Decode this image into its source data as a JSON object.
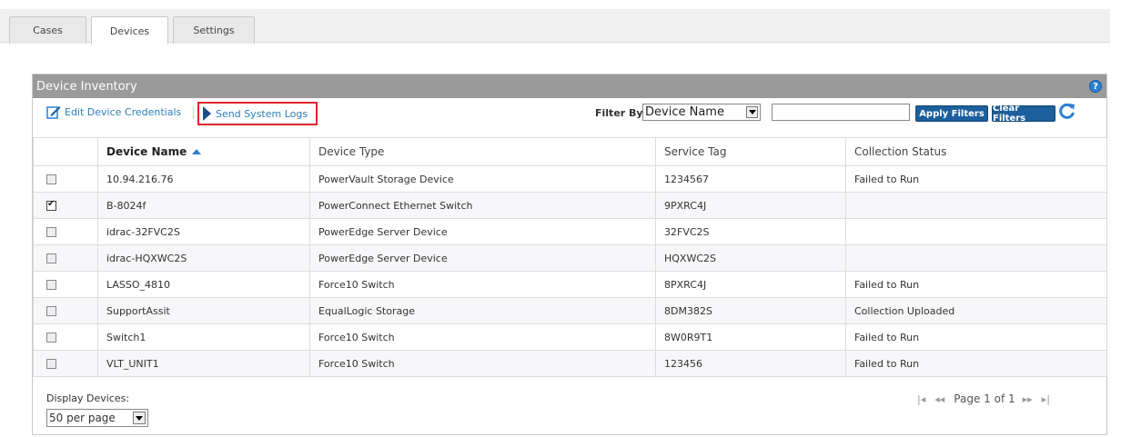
{
  "tabs": [
    {
      "label": "Cases"
    },
    {
      "label": "Devices"
    },
    {
      "label": "Settings"
    }
  ],
  "panel": {
    "title": "Device Inventory"
  },
  "toolbar": {
    "edit_label": "Edit Device Credentials",
    "send_logs_label": "Send System Logs",
    "filter_label": "Filter By:",
    "filter_selected": "Device Name",
    "filter_value": "",
    "apply_label": "Apply Filters",
    "clear_label": "Clear Filters"
  },
  "table": {
    "columns": [
      "Device Name",
      "Device Type",
      "Service Tag",
      "Collection Status"
    ],
    "rows": [
      {
        "checked": false,
        "name": "10.94.216.76",
        "type": "PowerVault Storage Device",
        "tag": "1234567",
        "status": "Failed to Run"
      },
      {
        "checked": true,
        "name": "B-8024f",
        "type": "PowerConnect Ethernet Switch",
        "tag": "9PXRC4J",
        "status": ""
      },
      {
        "checked": false,
        "name": "idrac-32FVC2S",
        "type": "PowerEdge Server Device",
        "tag": "32FVC2S",
        "status": ""
      },
      {
        "checked": false,
        "name": "idrac-HQXWC2S",
        "type": "PowerEdge Server Device",
        "tag": "HQXWC2S",
        "status": ""
      },
      {
        "checked": false,
        "name": "LASSO_4810",
        "type": "Force10 Switch",
        "tag": "8PXRC4J",
        "status": "Failed to Run"
      },
      {
        "checked": false,
        "name": "SupportAssit",
        "type": "EqualLogic Storage",
        "tag": "8DM382S",
        "status": "Collection Uploaded"
      },
      {
        "checked": false,
        "name": "Switch1",
        "type": "Force10 Switch",
        "tag": "8W0R9T1",
        "status": "Failed to Run"
      },
      {
        "checked": false,
        "name": "VLT_UNIT1",
        "type": "Force10 Switch",
        "tag": "123456",
        "status": "Failed to Run"
      }
    ]
  },
  "footer": {
    "display_label": "Display Devices:",
    "per_page": "50 per page",
    "page_text": "Page 1 of 1"
  },
  "colors": {
    "accent": "#1c5f9c",
    "link": "#2a7fb8",
    "header_bar": "#9a9a9a",
    "highlight": "#e0262b"
  }
}
